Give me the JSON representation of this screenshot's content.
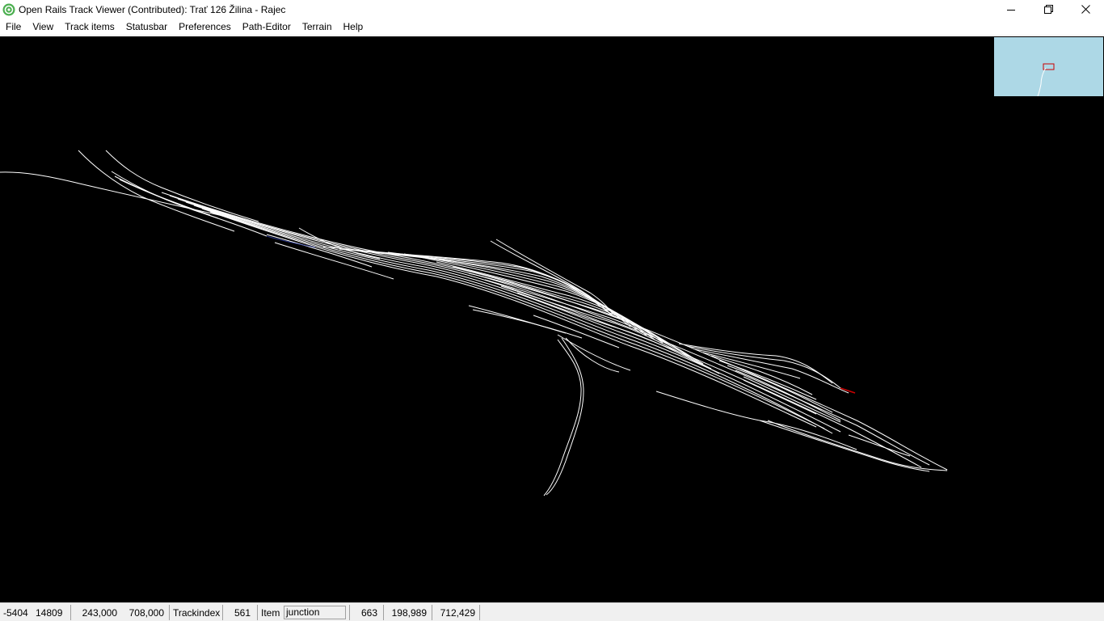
{
  "window": {
    "title": "Open Rails Track Viewer (Contributed): Trať 126 Žilina - Rajec",
    "app_icon": "open-rails-icon",
    "controls": [
      "minimize-icon",
      "restore-icon",
      "close-icon"
    ]
  },
  "menu": {
    "items": [
      "File",
      "View",
      "Track items",
      "Statusbar",
      "Preferences",
      "Path-Editor",
      "Terrain",
      "Help"
    ]
  },
  "canvas": {
    "background": "#000000",
    "track_color": "#ffffff",
    "highlight_color": "#cc0000",
    "minimap_color": "#add8e6",
    "minimap_frame_color": "#cc0000"
  },
  "statusbar": {
    "mouse_x": "-5404",
    "mouse_z": "14809",
    "tile_x": "243,000",
    "tile_z": "708,000",
    "trackindex_label": "Trackindex",
    "trackindex_value": "561",
    "item_label": "Item",
    "item_value": "junction",
    "item_index": "663",
    "item_x": "198,989",
    "item_z": "712,429"
  }
}
